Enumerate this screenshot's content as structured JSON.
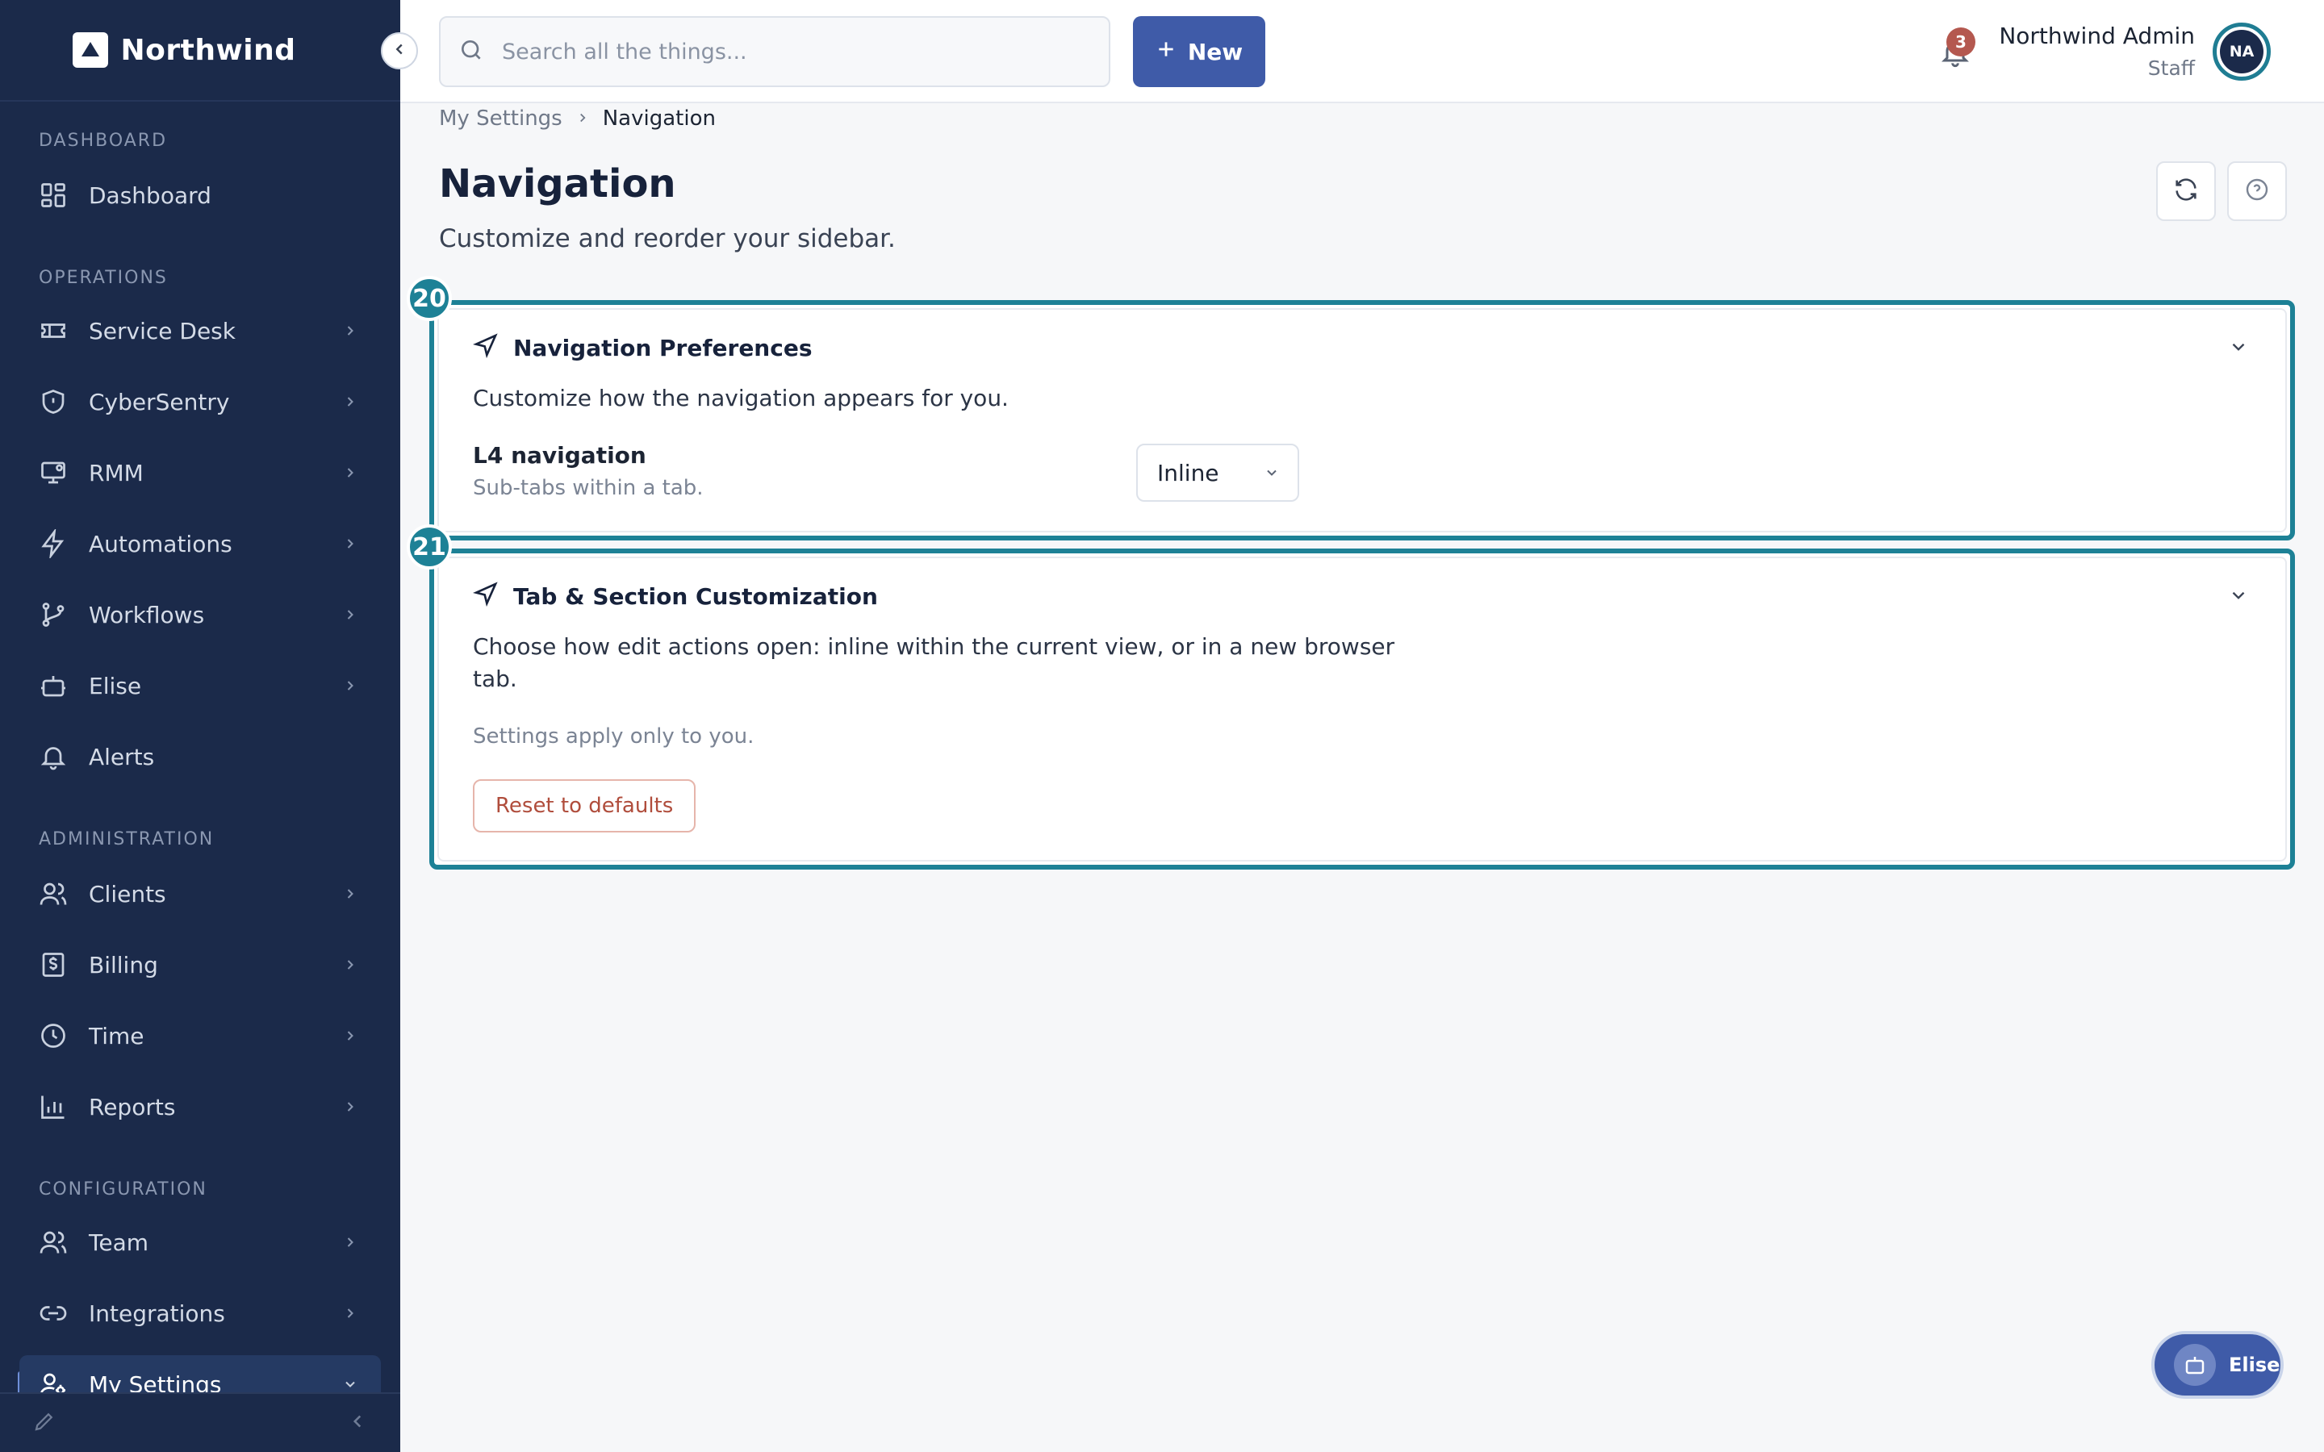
{
  "brand": {
    "name": "Northwind"
  },
  "sidebar": {
    "sections": {
      "dashboard": "DASHBOARD",
      "operations": "OPERATIONS",
      "administration": "ADMINISTRATION",
      "configuration": "CONFIGURATION"
    },
    "items": [
      {
        "label": "Dashboard",
        "icon": "grid-icon"
      },
      {
        "label": "Service Desk",
        "icon": "ticket-icon"
      },
      {
        "label": "CyberSentry",
        "icon": "shield-icon"
      },
      {
        "label": "RMM",
        "icon": "monitor-icon"
      },
      {
        "label": "Automations",
        "icon": "lightning-icon"
      },
      {
        "label": "Workflows",
        "icon": "branch-icon"
      },
      {
        "label": "Elise",
        "icon": "bot-icon"
      },
      {
        "label": "Alerts",
        "icon": "bell-icon"
      },
      {
        "label": "Clients",
        "icon": "users-icon"
      },
      {
        "label": "Billing",
        "icon": "receipt-icon"
      },
      {
        "label": "Time",
        "icon": "clock-icon"
      },
      {
        "label": "Reports",
        "icon": "bar-chart-icon"
      },
      {
        "label": "Team",
        "icon": "users-icon"
      },
      {
        "label": "Integrations",
        "icon": "link-icon"
      },
      {
        "label": "My Settings",
        "icon": "user-gear-icon"
      }
    ]
  },
  "topbar": {
    "search_placeholder": "Search all the things...",
    "new_label": "New",
    "notification_count": "3",
    "user_name": "Northwind Admin",
    "user_role": "Staff",
    "avatar_initials": "NA"
  },
  "breadcrumb": {
    "parent": "My Settings",
    "current": "Navigation"
  },
  "page": {
    "title": "Navigation",
    "subtitle": "Customize and reorder your sidebar."
  },
  "cards": {
    "prefs": {
      "badge": "20",
      "title": "Navigation Preferences",
      "description": "Customize how the navigation appears for you.",
      "field_label": "L4 navigation",
      "field_hint": "Sub-tabs within a tab.",
      "select_value": "Inline"
    },
    "tabs": {
      "badge": "21",
      "title": "Tab & Section Customization",
      "description_line1": "Choose how edit actions open: inline within the current view, or in a new browser",
      "description_line2": "tab.",
      "note": "Settings apply only to you.",
      "reset_label": "Reset to defaults"
    }
  },
  "assistant": {
    "label": "Elise"
  },
  "colors": {
    "sidebar_bg": "#1b2a4a",
    "accent": "#3f5ba8",
    "highlight": "#1d8196",
    "danger": "#b04d3c"
  }
}
